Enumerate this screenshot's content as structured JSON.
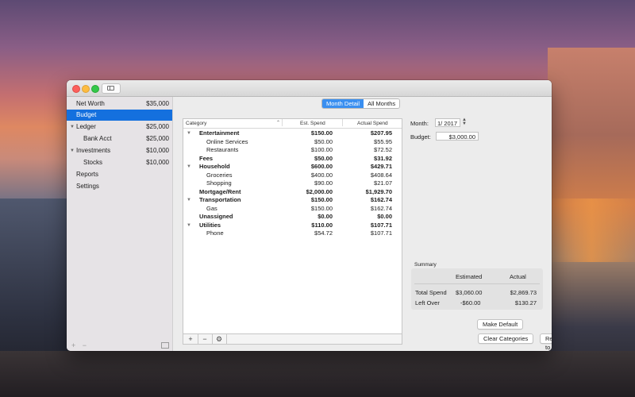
{
  "sidebar": {
    "items": [
      {
        "label": "Net Worth",
        "amount": "$35,000"
      },
      {
        "label": "Budget",
        "amount": ""
      },
      {
        "label": "Ledger",
        "amount": "$25,000"
      },
      {
        "label": "Bank Acct",
        "amount": "$25,000"
      },
      {
        "label": "Investments",
        "amount": "$10,000"
      },
      {
        "label": "Stocks",
        "amount": "$10,000"
      },
      {
        "label": "Reports",
        "amount": ""
      },
      {
        "label": "Settings",
        "amount": ""
      }
    ],
    "selected": "Budget",
    "footer": {
      "add": "+",
      "remove": "−"
    }
  },
  "segmented": {
    "month_detail": "Month Detail",
    "all_months": "All Months",
    "selected": "Month Detail"
  },
  "table": {
    "headers": {
      "category": "Category",
      "est": "Est. Spend",
      "actual": "Actual Spend"
    },
    "rows": [
      {
        "category": "Entertainment",
        "est": "$150.00",
        "actual": "$207.95",
        "bold": true,
        "expandable": true
      },
      {
        "category": "Online Services",
        "est": "$50.00",
        "actual": "$55.95",
        "bold": false,
        "expandable": false
      },
      {
        "category": "Restaurants",
        "est": "$100.00",
        "actual": "$72.52",
        "bold": false,
        "expandable": false
      },
      {
        "category": "Fees",
        "est": "$50.00",
        "actual": "$31.92",
        "bold": true,
        "expandable": false
      },
      {
        "category": "Household",
        "est": "$600.00",
        "actual": "$429.71",
        "bold": true,
        "expandable": true
      },
      {
        "category": "Groceries",
        "est": "$400.00",
        "actual": "$408.64",
        "bold": false,
        "expandable": false
      },
      {
        "category": "Shopping",
        "est": "$90.00",
        "actual": "$21.07",
        "bold": false,
        "expandable": false
      },
      {
        "category": "Mortgage/Rent",
        "est": "$2,000.00",
        "actual": "$1,929.70",
        "bold": true,
        "expandable": false
      },
      {
        "category": "Transportation",
        "est": "$150.00",
        "actual": "$162.74",
        "bold": true,
        "expandable": true
      },
      {
        "category": "Gas",
        "est": "$150.00",
        "actual": "$162.74",
        "bold": false,
        "expandable": false
      },
      {
        "category": "Unassigned",
        "est": "$0.00",
        "actual": "$0.00",
        "bold": true,
        "expandable": false
      },
      {
        "category": "Utilities",
        "est": "$110.00",
        "actual": "$107.71",
        "bold": true,
        "expandable": true
      },
      {
        "category": "Phone",
        "est": "$54.72",
        "actual": "$107.71",
        "bold": false,
        "expandable": false
      }
    ],
    "footer": {
      "add": "+",
      "remove": "−",
      "gear": "⚙"
    }
  },
  "form": {
    "month_label": "Month:",
    "month_value": "1/ 2017",
    "budget_label": "Budget:",
    "budget_value": "$3,000.00"
  },
  "summary": {
    "title": "Summary",
    "col_estimated": "Estimated",
    "col_actual": "Actual",
    "rows": [
      {
        "label": "Total Spend",
        "estimated": "$3,060.00",
        "actual": "$2,869.73"
      },
      {
        "label": "Left Over",
        "estimated": "-$60.00",
        "actual": "$130.27"
      }
    ]
  },
  "buttons": {
    "make_default": "Make Default",
    "clear_categories": "Clear Categories",
    "reset_defaults": "Reset to Defaults"
  }
}
